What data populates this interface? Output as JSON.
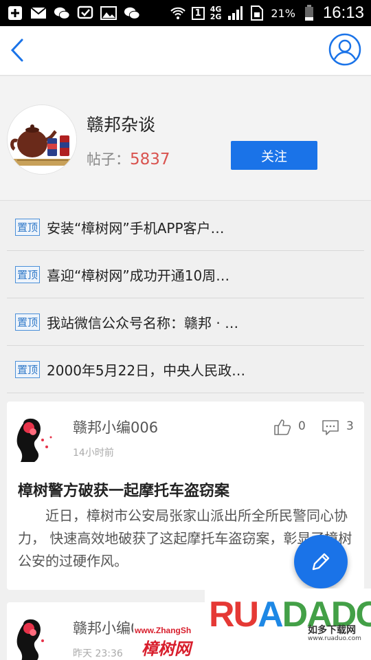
{
  "status_bar": {
    "network": "4G",
    "network2": "2G",
    "sim": "1",
    "battery": "21%",
    "time": "16:13"
  },
  "nav": {
    "back_icon": "chevron-left-icon",
    "user_icon": "user-circle-icon"
  },
  "forum": {
    "name": "赣邦杂谈",
    "posts_label": "帖子：",
    "posts_count": "5837",
    "follow_label": "关注"
  },
  "pinned": {
    "badge": "置顶",
    "items": [
      "安装“樟树网”手机APP客户…",
      "喜迎“樟树网”成功开通10周…",
      "我站微信公众号名称：赣邦 · …",
      "2000年5月22日，中央人民政…"
    ]
  },
  "posts": [
    {
      "author": "赣邦小编006",
      "time": "14小时前",
      "likes": "0",
      "comments": "3",
      "title": "樟树警方破获一起摩托车盗窃案",
      "body": "近日，樟树市公安局张家山派出所全所民警同心协力， 快速高效地破获了这起摩托车盗窃案，彰显了樟树公安的过硬作风。"
    },
    {
      "author": "赣邦小编006",
      "time": "昨天 23:36"
    }
  ],
  "watermark": {
    "url": "www.ZhangSh",
    "site": "樟树网",
    "brand_r": "RU",
    "brand_a": "A",
    "brand_d": "DADO",
    "sub": "如多下载网",
    "sub_url": "www.ruaduo.com"
  },
  "colors": {
    "accent": "#1a73e8",
    "count": "#d9534f"
  }
}
